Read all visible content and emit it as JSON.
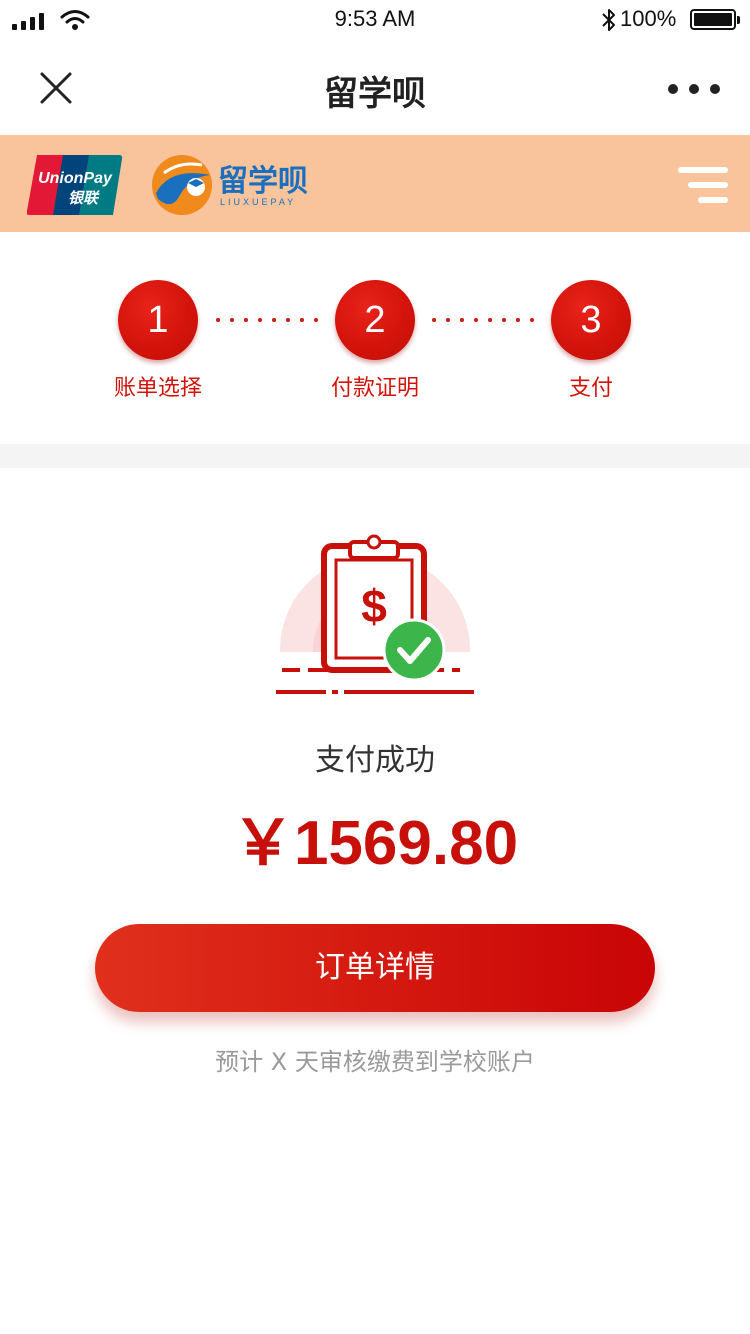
{
  "status_bar": {
    "time": "9:53 AM",
    "battery": "100%",
    "icons": [
      "signal-icon",
      "wifi-icon",
      "bluetooth-icon",
      "battery-icon"
    ]
  },
  "nav": {
    "title": "留学呗",
    "close_icon": "close-icon",
    "more_icon": "more-dots-icon"
  },
  "brand": {
    "unionpay_text_top": "UnionPay",
    "unionpay_text_bottom": "银联",
    "logo_cn": "留学呗",
    "logo_en": "LIUXUEPAY",
    "background": "#f9c39c",
    "menu_icon": "menu-icon"
  },
  "steps": [
    {
      "number": "1",
      "label": "账单选择"
    },
    {
      "number": "2",
      "label": "付款证明"
    },
    {
      "number": "3",
      "label": "支付"
    }
  ],
  "result": {
    "illustration_icon": "payment-success-clipboard-icon",
    "status": "支付成功",
    "amount": "￥1569.80",
    "order_button": "订单详情",
    "note": "预计 X 天审核缴费到学校账户"
  },
  "colors": {
    "accent": "#d4140c",
    "success_check": "#3cb54a"
  }
}
